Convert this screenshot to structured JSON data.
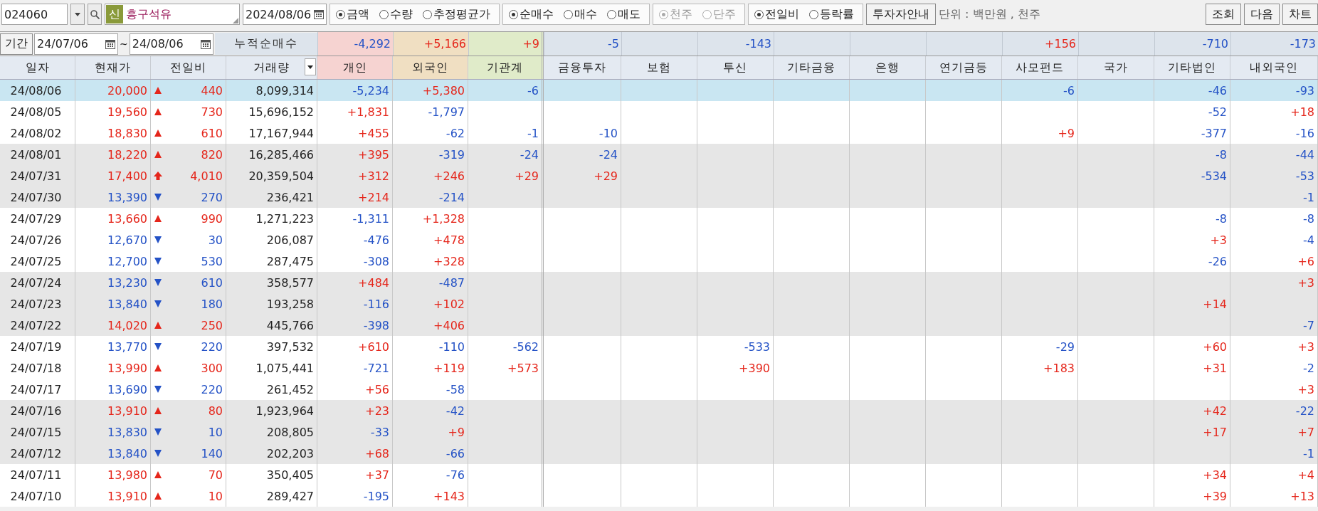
{
  "toolbar": {
    "code": "024060",
    "badge": "신",
    "name": "흥구석유",
    "date": "2024/08/06",
    "radio_groups": [
      {
        "disabled": false,
        "options": [
          {
            "label": "금액",
            "selected": true
          },
          {
            "label": "수량",
            "selected": false
          },
          {
            "label": "추정평균가",
            "selected": false
          }
        ]
      },
      {
        "disabled": false,
        "options": [
          {
            "label": "순매수",
            "selected": true
          },
          {
            "label": "매수",
            "selected": false
          },
          {
            "label": "매도",
            "selected": false
          }
        ]
      },
      {
        "disabled": true,
        "options": [
          {
            "label": "천주",
            "selected": true
          },
          {
            "label": "단주",
            "selected": false
          }
        ]
      },
      {
        "disabled": false,
        "options": [
          {
            "label": "전일비",
            "selected": true
          },
          {
            "label": "등락률",
            "selected": false
          }
        ]
      }
    ],
    "guide_button": "투자자안내",
    "unit": "단위 : 백만원 , 천주",
    "buttons": [
      "조회",
      "다음",
      "차트"
    ]
  },
  "period": {
    "label": "기간",
    "from": "24/07/06",
    "separator": "~",
    "to": "24/08/06",
    "total_label": "누적순매수",
    "totals": {
      "individual": "-4,292",
      "foreign": "+5,166",
      "institution": "+9",
      "fin_invest": "-5",
      "trust": "-143",
      "private_fund": "+156",
      "other_corp": "-710",
      "domestic_foreign": "-173"
    }
  },
  "table": {
    "columns": [
      {
        "label": "일자"
      },
      {
        "label": "현재가"
      },
      {
        "label": "전일비"
      },
      {
        "label": "거래량",
        "menu": true
      },
      {
        "label": "개인",
        "color": "#f6d3d1"
      },
      {
        "label": "외국인",
        "color": "#f0dfc2"
      },
      {
        "label": "기관계",
        "color": "#e0ebc9"
      },
      {
        "label": "금융투자"
      },
      {
        "label": "보험"
      },
      {
        "label": "투신"
      },
      {
        "label": "기타금융"
      },
      {
        "label": "은행"
      },
      {
        "label": "연기금등"
      },
      {
        "label": "사모펀드"
      },
      {
        "label": "국가"
      },
      {
        "label": "기타법인"
      },
      {
        "label": "내외국인"
      }
    ],
    "rows": [
      {
        "selected": true,
        "date": "24/08/06",
        "price": "20,000",
        "kind": "up",
        "change": "440",
        "volume": "8,099,314",
        "individual": "-5,234",
        "foreign": "+5,380",
        "institution": "-6",
        "private_fund": "-6",
        "other_corp": "-46",
        "domestic_foreign": "-93"
      },
      {
        "selected": false,
        "date": "24/08/05",
        "price": "19,560",
        "kind": "up",
        "change": "730",
        "volume": "15,696,152",
        "individual": "+1,831",
        "foreign": "-1,797",
        "other_corp": "-52",
        "domestic_foreign": "+18"
      },
      {
        "selected": false,
        "date": "24/08/02",
        "price": "18,830",
        "kind": "up",
        "change": "610",
        "volume": "17,167,944",
        "individual": "+455",
        "foreign": "-62",
        "institution": "-1",
        "fin_invest": "-10",
        "private_fund": "+9",
        "other_corp": "-377",
        "domestic_foreign": "-16"
      },
      {
        "selected": false,
        "date": "24/08/01",
        "price": "18,220",
        "kind": "up",
        "change": "820",
        "volume": "16,285,466",
        "individual": "+395",
        "foreign": "-319",
        "institution": "-24",
        "fin_invest": "-24",
        "other_corp": "-8",
        "domestic_foreign": "-44"
      },
      {
        "selected": false,
        "date": "24/07/31",
        "price": "17,400",
        "kind": "limit_up",
        "change": "4,010",
        "volume": "20,359,504",
        "individual": "+312",
        "foreign": "+246",
        "institution": "+29",
        "fin_invest": "+29",
        "other_corp": "-534",
        "domestic_foreign": "-53"
      },
      {
        "selected": false,
        "date": "24/07/30",
        "price": "13,390",
        "kind": "down",
        "change": "270",
        "volume": "236,421",
        "individual": "+214",
        "foreign": "-214",
        "domestic_foreign": "-1"
      },
      {
        "selected": false,
        "date": "24/07/29",
        "price": "13,660",
        "kind": "up",
        "change": "990",
        "volume": "1,271,223",
        "individual": "-1,311",
        "foreign": "+1,328",
        "other_corp": "-8",
        "domestic_foreign": "-8"
      },
      {
        "selected": false,
        "date": "24/07/26",
        "price": "12,670",
        "kind": "down",
        "change": "30",
        "volume": "206,087",
        "individual": "-476",
        "foreign": "+478",
        "other_corp": "+3",
        "domestic_foreign": "-4"
      },
      {
        "selected": false,
        "date": "24/07/25",
        "price": "12,700",
        "kind": "down",
        "change": "530",
        "volume": "287,475",
        "individual": "-308",
        "foreign": "+328",
        "other_corp": "-26",
        "domestic_foreign": "+6"
      },
      {
        "selected": false,
        "date": "24/07/24",
        "price": "13,230",
        "kind": "down",
        "change": "610",
        "volume": "358,577",
        "individual": "+484",
        "foreign": "-487",
        "domestic_foreign": "+3"
      },
      {
        "selected": false,
        "date": "24/07/23",
        "price": "13,840",
        "kind": "down",
        "change": "180",
        "volume": "193,258",
        "individual": "-116",
        "foreign": "+102",
        "other_corp": "+14"
      },
      {
        "selected": false,
        "date": "24/07/22",
        "price": "14,020",
        "kind": "up",
        "change": "250",
        "volume": "445,766",
        "individual": "-398",
        "foreign": "+406",
        "domestic_foreign": "-7"
      },
      {
        "selected": false,
        "date": "24/07/19",
        "price": "13,770",
        "kind": "down",
        "change": "220",
        "volume": "397,532",
        "individual": "+610",
        "foreign": "-110",
        "institution": "-562",
        "trust": "-533",
        "private_fund": "-29",
        "other_corp": "+60",
        "domestic_foreign": "+3"
      },
      {
        "selected": false,
        "date": "24/07/18",
        "price": "13,990",
        "kind": "up",
        "change": "300",
        "volume": "1,075,441",
        "individual": "-721",
        "foreign": "+119",
        "institution": "+573",
        "trust": "+390",
        "private_fund": "+183",
        "other_corp": "+31",
        "domestic_foreign": "-2"
      },
      {
        "selected": false,
        "date": "24/07/17",
        "price": "13,690",
        "kind": "down",
        "change": "220",
        "volume": "261,452",
        "individual": "+56",
        "foreign": "-58",
        "domestic_foreign": "+3"
      },
      {
        "selected": false,
        "date": "24/07/16",
        "price": "13,910",
        "kind": "up",
        "change": "80",
        "volume": "1,923,964",
        "individual": "+23",
        "foreign": "-42",
        "other_corp": "+42",
        "domestic_foreign": "-22"
      },
      {
        "selected": false,
        "date": "24/07/15",
        "price": "13,830",
        "kind": "down",
        "change": "10",
        "volume": "208,805",
        "individual": "-33",
        "foreign": "+9",
        "other_corp": "+17",
        "domestic_foreign": "+7"
      },
      {
        "selected": false,
        "date": "24/07/12",
        "price": "13,840",
        "kind": "down",
        "change": "140",
        "volume": "202,203",
        "individual": "+68",
        "foreign": "-66",
        "domestic_foreign": "-1"
      },
      {
        "selected": false,
        "date": "24/07/11",
        "price": "13,980",
        "kind": "up",
        "change": "70",
        "volume": "350,405",
        "individual": "+37",
        "foreign": "-76",
        "other_corp": "+34",
        "domestic_foreign": "+4"
      },
      {
        "selected": false,
        "date": "24/07/10",
        "price": "13,910",
        "kind": "up",
        "change": "10",
        "volume": "289,427",
        "individual": "-195",
        "foreign": "+143",
        "other_corp": "+39",
        "domestic_foreign": "+13"
      }
    ]
  }
}
